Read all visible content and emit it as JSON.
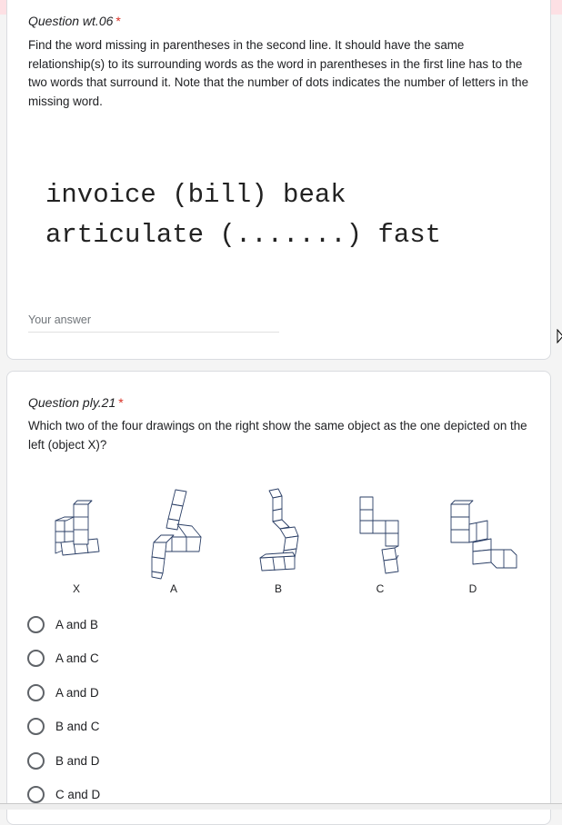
{
  "question1": {
    "title": "Question wt.06",
    "required_mark": "*",
    "description": "Find the word missing in parentheses in the second line. It should have the same relationship(s) to its surrounding words as the word in parentheses in the first line has to the two words that surround it. Note that the number of dots indicates the number of letters in the missing word.",
    "puzzle_line1": "invoice (bill) beak",
    "puzzle_line2": "articulate (.......) fast",
    "answer_placeholder": "Your answer",
    "answer_value": ""
  },
  "question2": {
    "title": "Question ply.21",
    "required_mark": "*",
    "description": "Which two of the four drawings on the right show the same object as the one depicted on the left (object X)?",
    "figures": [
      {
        "label": "X",
        "icon": "cube-object-x"
      },
      {
        "label": "A",
        "icon": "cube-object-a"
      },
      {
        "label": "B",
        "icon": "cube-object-b"
      },
      {
        "label": "C",
        "icon": "cube-object-c"
      },
      {
        "label": "D",
        "icon": "cube-object-d"
      }
    ],
    "options": [
      {
        "label": "A and B",
        "selected": false
      },
      {
        "label": "A and C",
        "selected": false
      },
      {
        "label": "A and D",
        "selected": false
      },
      {
        "label": "B and C",
        "selected": false
      },
      {
        "label": "B and D",
        "selected": false
      },
      {
        "label": "C and D",
        "selected": false
      }
    ]
  },
  "colors": {
    "required": "#d93025",
    "page_background": "#f4f4f4",
    "top_banner": "#fde0e4",
    "cube_stroke": "#2b3f66"
  }
}
